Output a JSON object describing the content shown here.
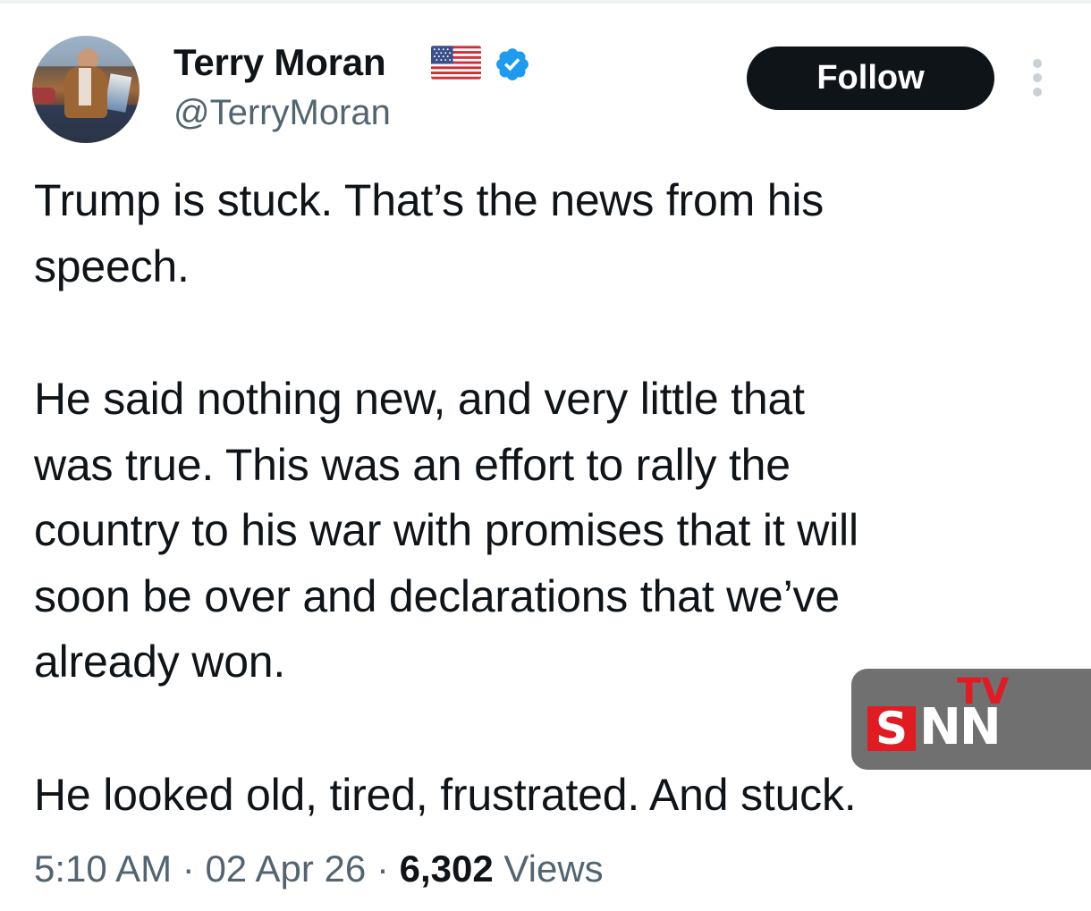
{
  "author": {
    "display_name": "Terry Moran",
    "handle": "@TerryMoran",
    "verified": true
  },
  "follow_button": {
    "label": "Follow"
  },
  "tweet": {
    "paragraphs": [
      [
        "Trump is stuck. That’s the news from his",
        "speech."
      ],
      [
        "He said nothing new, and very little that",
        "was true. This was an effort to rally the",
        "country to his war with promises that it will",
        "soon be over and declarations that we’ve",
        "already won."
      ],
      [
        "He looked old, tired, frustrated. And stuck."
      ]
    ]
  },
  "meta": {
    "time": "5:10 AM",
    "separator": "·",
    "date": "02 Apr 26",
    "views_count": "6,302",
    "views_label": "Views"
  },
  "watermark": {
    "s": "S",
    "nn": "NN",
    "tv": "TV"
  },
  "icons": {
    "flag": "us-flag-emoji",
    "verified": "verified-badge-icon",
    "more": "more-options-icon"
  },
  "colors": {
    "text": "#0f1419",
    "secondary": "#536471",
    "verified_blue": "#1d9bf0",
    "follow_bg": "#0f1419",
    "watermark_red": "#e21a22",
    "watermark_gray": "#707070"
  }
}
